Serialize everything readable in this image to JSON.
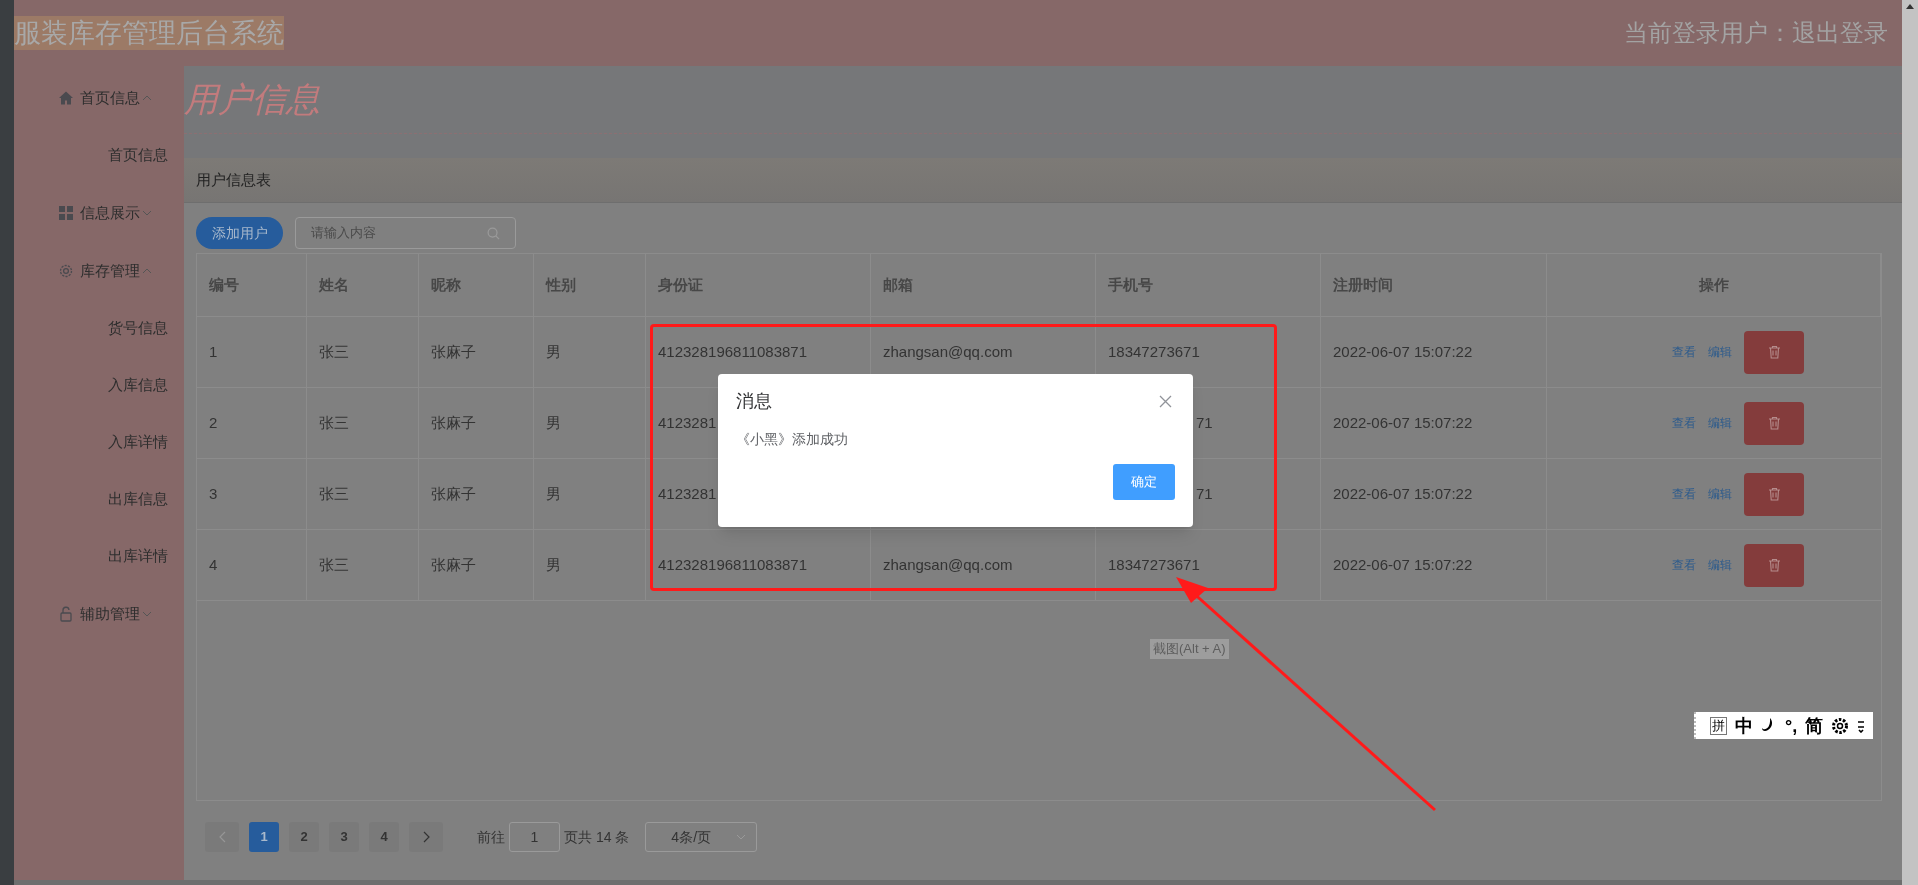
{
  "header": {
    "title": "服装库存管理后台系统",
    "title_highlighted": true,
    "user_area": "当前登录用户：退出登录"
  },
  "sidebar": {
    "items": [
      {
        "label": "首页信息",
        "expanded": true,
        "children": [
          {
            "label": "首页信息"
          }
        ]
      },
      {
        "label": "信息展示",
        "expanded": false
      },
      {
        "label": "库存管理",
        "expanded": true,
        "children": [
          {
            "label": "货号信息"
          },
          {
            "label": "入库信息"
          },
          {
            "label": "入库详情"
          },
          {
            "label": "出库信息"
          },
          {
            "label": "出库详情"
          }
        ]
      },
      {
        "label": "辅助管理",
        "expanded": false
      }
    ]
  },
  "page_title": "用户信息",
  "card": {
    "title": "用户信息表",
    "add_button": "添加用户",
    "search": {
      "placeholder": "请输入内容"
    }
  },
  "table": {
    "columns": [
      "编号",
      "姓名",
      "昵称",
      "性别",
      "身份证",
      "邮箱",
      "手机号",
      "注册时间",
      "操作"
    ],
    "rows": [
      {
        "cells": [
          {
            "text": "1"
          },
          {
            "text": "张三"
          },
          {
            "text": "张麻子"
          },
          {
            "text": "男"
          },
          {
            "text": "412328196811083871"
          },
          {
            "text": "zhangsan@qq.com"
          },
          {
            "text": "18347273671"
          },
          {
            "text": "2022-06-07 15:07:22"
          }
        ],
        "actions": [
          "查看",
          "编辑"
        ]
      },
      {
        "cells": [
          {
            "text": "2"
          },
          {
            "text": "张三"
          },
          {
            "text": "张麻子"
          },
          {
            "text": "男"
          },
          {
            "text": "4123281"
          },
          null,
          {
            "text": "71",
            "cut_start": true
          },
          {
            "text": "2022-06-07 15:07:22"
          }
        ],
        "actions": [
          "查看",
          "编辑"
        ]
      },
      {
        "cells": [
          {
            "text": "3"
          },
          {
            "text": "张三"
          },
          {
            "text": "张麻子"
          },
          {
            "text": "男"
          },
          {
            "text": "4123281"
          },
          null,
          {
            "text": "71",
            "cut_start": true
          },
          {
            "text": "2022-06-07 15:07:22"
          }
        ],
        "actions": [
          "查看",
          "编辑"
        ]
      },
      {
        "cells": [
          {
            "text": "4"
          },
          {
            "text": "张三"
          },
          {
            "text": "张麻子"
          },
          {
            "text": "男"
          },
          {
            "text": "412328196811083871"
          },
          {
            "text": "zhangsan@qq.com"
          },
          {
            "text": "18347273671"
          },
          {
            "text": "2022-06-07 15:07:22"
          }
        ],
        "actions": [
          "查看",
          "编辑"
        ]
      }
    ]
  },
  "pagination": {
    "prev_disabled": true,
    "pages": [
      {
        "label": "1",
        "selected": true
      },
      {
        "label": "2",
        "selected": false
      },
      {
        "label": "3",
        "selected": false
      },
      {
        "label": "4",
        "selected": false
      }
    ],
    "jump_label": "前往",
    "jump_value": "1",
    "total": "页共 14 条",
    "page_size": "4条/页"
  },
  "dialog": {
    "title": "消息",
    "message": "《小黑》添加成功",
    "confirm": "确定"
  },
  "screenshot_hint": "截图(Alt + A)",
  "ime_toolbar": {
    "items": [
      {
        "kind": "box",
        "label": "拼"
      },
      {
        "kind": "text",
        "label": "中"
      },
      {
        "kind": "moon"
      },
      {
        "kind": "text",
        "label": "°,"
      },
      {
        "kind": "text",
        "label": "简"
      },
      {
        "kind": "gear"
      },
      {
        "kind": "more"
      }
    ]
  }
}
